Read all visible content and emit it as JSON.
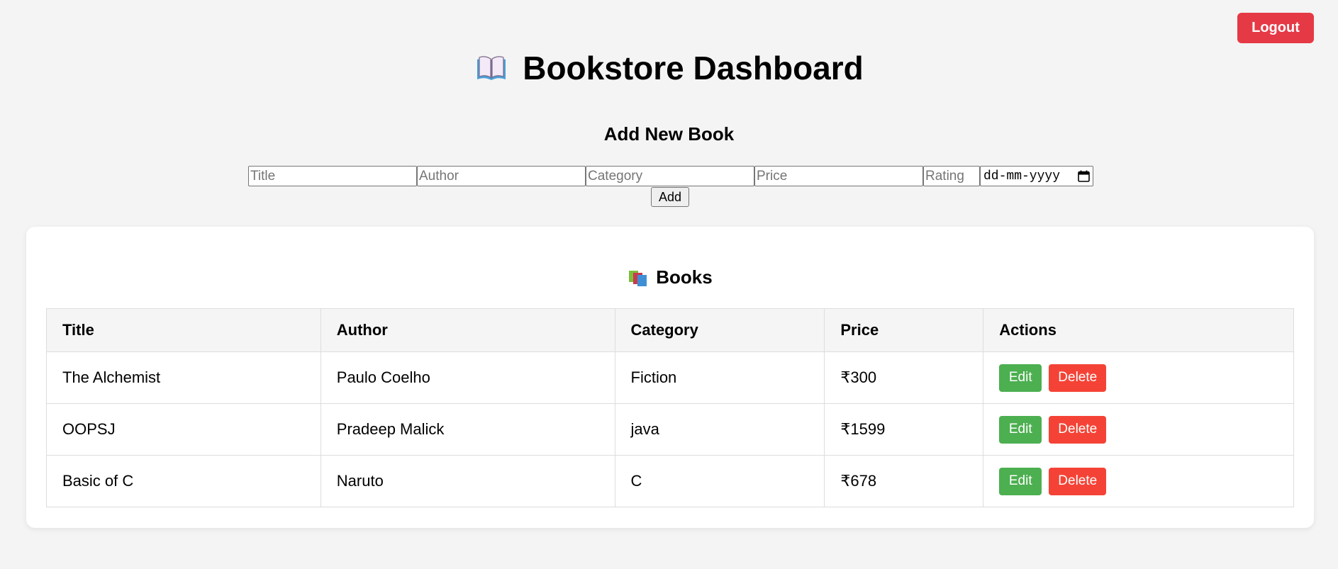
{
  "header": {
    "title": "Bookstore Dashboard",
    "icon": "open-book-icon",
    "logout_label": "Logout"
  },
  "add_form": {
    "heading": "Add New Book",
    "title_placeholder": "Title",
    "author_placeholder": "Author",
    "category_placeholder": "Category",
    "price_placeholder": "Price",
    "rating_placeholder": "Rating",
    "date_placeholder": "dd-mm-yyyy",
    "add_label": "Add"
  },
  "books_section": {
    "heading": "Books",
    "icon": "books-icon",
    "columns": [
      "Title",
      "Author",
      "Category",
      "Price",
      "Actions"
    ],
    "rows": [
      {
        "title": "The Alchemist",
        "author": "Paulo Coelho",
        "category": "Fiction",
        "price": "₹300",
        "edit_label": "Edit",
        "delete_label": "Delete"
      },
      {
        "title": "OOPSJ",
        "author": "Pradeep Malick",
        "category": "java",
        "price": "₹1599",
        "edit_label": "Edit",
        "delete_label": "Delete"
      },
      {
        "title": "Basic of C",
        "author": "Naruto",
        "category": "C",
        "price": "₹678",
        "edit_label": "Edit",
        "delete_label": "Delete"
      }
    ]
  },
  "colors": {
    "background": "#f4f4f4",
    "logout": "#e63946",
    "edit": "#4caf50",
    "delete": "#f44336"
  }
}
